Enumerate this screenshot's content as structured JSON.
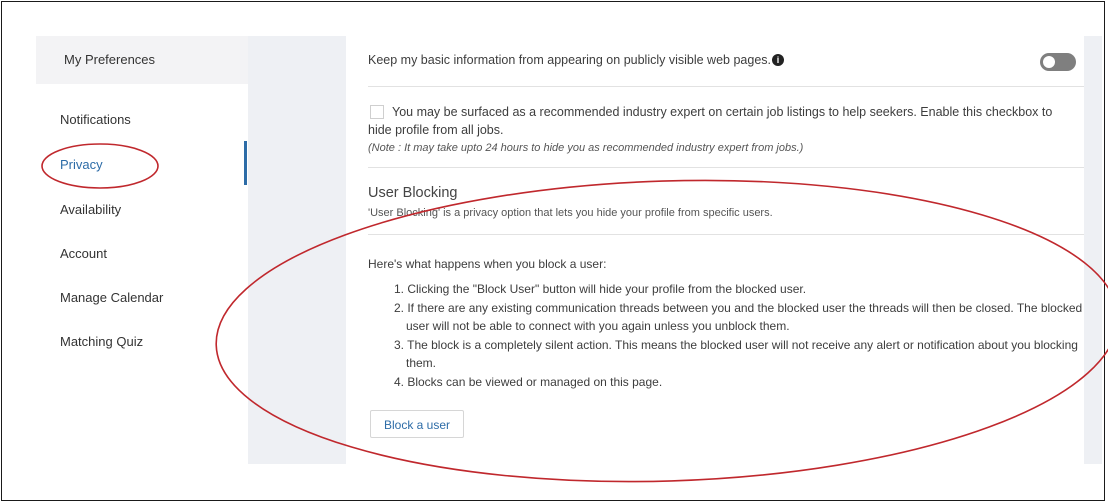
{
  "sidebar": {
    "header": "My Preferences",
    "items": [
      {
        "label": "Notifications"
      },
      {
        "label": "Privacy"
      },
      {
        "label": "Availability"
      },
      {
        "label": "Account"
      },
      {
        "label": "Manage Calendar"
      },
      {
        "label": "Matching Quiz"
      }
    ],
    "active_item": "Privacy"
  },
  "privacy": {
    "basic_info_text": "Keep my basic information from appearing on publicly visible web pages.",
    "info_icon": "i",
    "basic_info_toggle": "off",
    "expert_checkbox": {
      "checked": false,
      "line1": "You may be surfaced as a recommended industry expert on certain job listings to help seekers. Enable this checkbox to",
      "line2": "hide profile from all jobs.",
      "note": "(Note : It may take upto 24 hours to hide you as recommended industry expert from jobs.)"
    },
    "user_blocking": {
      "title": "User Blocking",
      "subtitle": "'User Blocking' is a privacy option that lets you hide your profile from specific users.",
      "intro": "Here's what happens when you block a user:",
      "steps": [
        "1. Clicking the \"Block User\" button will hide your profile from the blocked user.",
        "2. If there are any existing communication threads between you and the blocked user the threads will then be closed. The blocked user will not be able to connect with you again unless you unblock them.",
        "3. The block is a completely silent action. This means the blocked user will not receive any alert or notification about you blocking them.",
        "4. Blocks can be viewed or managed on this page."
      ],
      "button_label": "Block a user"
    }
  },
  "annotations": {
    "color": "#c0282d",
    "shapes": [
      "ellipse around Privacy menu item",
      "ellipse around User Blocking section"
    ]
  },
  "colors": {
    "accent": "#2d6ca7",
    "annotation": "#c0282d",
    "gutter": "#eef0f4",
    "toggle_off": "#7f7f7f"
  }
}
